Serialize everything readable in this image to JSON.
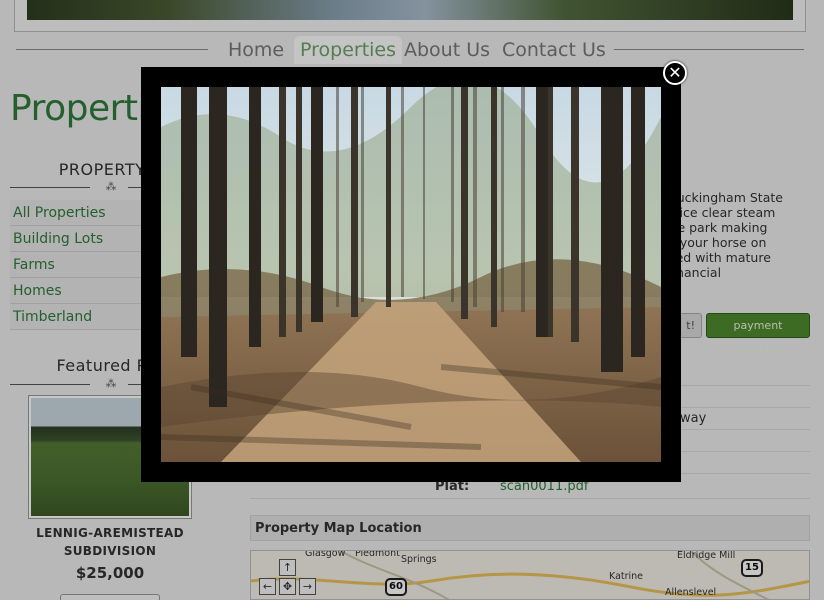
{
  "nav": {
    "items": [
      {
        "label": "Home"
      },
      {
        "label": "Properties"
      },
      {
        "label": "About Us"
      },
      {
        "label": "Contact Us"
      }
    ]
  },
  "page": {
    "heading": "Propertie"
  },
  "sidebar": {
    "property_types_title": "PROPERTY T",
    "items": [
      "All Properties",
      "Building Lots",
      "Farms",
      "Homes",
      "Timberland"
    ],
    "featured_title": "Featured Pro",
    "featured": {
      "name": "LENNIG-AREMISTEAD SUBDIVISION",
      "price": "$25,000"
    }
  },
  "content": {
    "description_lines": [
      "/ Buckingham State",
      "a nice clear steam",
      "tate park making",
      "ng your horse on",
      "aded with mature",
      ": financial"
    ],
    "partial_button": "t!",
    "calc_button": "payment calculator",
    "detail_value": "way",
    "plat_label": "Plat:",
    "plat_link": "scan0011.pdf",
    "map_heading": "Property Map Location",
    "map_labels": {
      "glasgow": "Glasgow",
      "piedmont": "Piedmont",
      "springs": "Springs",
      "eldridge": "Eldridge Mill",
      "katrine": "Katrine",
      "allenslevel": "Allenslevel",
      "route60": "60",
      "route15": "15"
    }
  },
  "lightbox": {
    "close_symbol": "✕"
  },
  "colors": {
    "brand_green": "#2f7a3a",
    "button_green": "#4f8a2f"
  }
}
